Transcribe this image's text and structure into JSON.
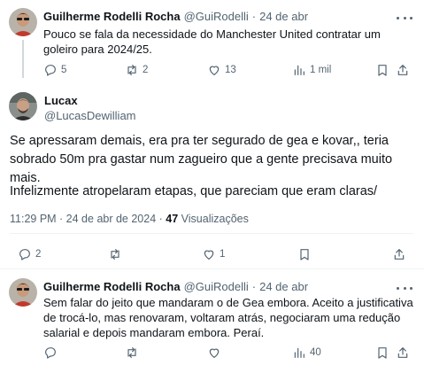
{
  "tweet1": {
    "author_name": "Guilherme Rodelli Rocha",
    "author_handle": "@GuiRodelli",
    "separator": "·",
    "date": "24 de abr",
    "text": "Pouco se fala da necessidade do Manchester United contratar um goleiro para 2024/25.",
    "replies": "5",
    "retweets": "2",
    "likes": "13",
    "views": "1 mil"
  },
  "main_tweet": {
    "author_name": "Lucax",
    "author_handle": "@LucasDewilliam",
    "text_p1": "Se apressaram demais, era pra ter segurado de gea e kovar,, teria sobrado 50m pra gastar num zagueiro que a gente precisava muito mais.",
    "text_p2": "Infelizmente atropelaram etapas, que pareciam que eram claras/",
    "time": "11:29 PM · 24 de abr de 2024 · ",
    "views_count": "47",
    "views_label": " Visualizações",
    "replies": "2",
    "likes": "1"
  },
  "tweet3": {
    "author_name": "Guilherme Rodelli Rocha",
    "author_handle": "@GuiRodelli",
    "separator": "·",
    "date": "24 de abr",
    "text": "Sem falar do jeito que mandaram o de Gea embora. Aceito a justificativa de trocá-lo, mas renovaram, voltaram atrás, negociaram uma redução salarial e depois mandaram embora. Peraí.",
    "views": "40"
  },
  "colors": {
    "text": "#0f1419",
    "secondary": "#536471",
    "divider": "#eff3f4",
    "thread_line": "#cfd9de"
  },
  "icons": [
    "more-icon",
    "reply-icon",
    "retweet-icon",
    "like-icon",
    "views-icon",
    "bookmark-icon",
    "share-icon"
  ]
}
